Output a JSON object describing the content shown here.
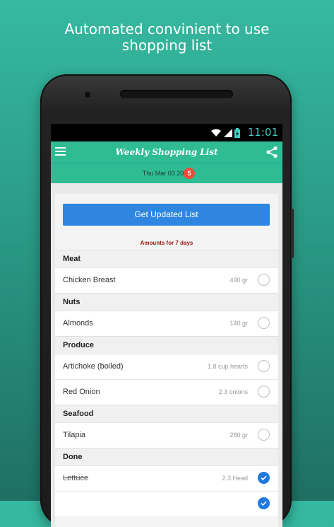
{
  "headline": {
    "line1": "Automated convinient to use",
    "line2": "shopping list"
  },
  "statusbar": {
    "time": "11:01",
    "icons": [
      "wifi-icon",
      "signal-icon",
      "battery-icon"
    ]
  },
  "appbar": {
    "title": "Weekly Shopping List",
    "menu_icon": "menu-icon",
    "share_icon": "share-icon"
  },
  "datebar": {
    "date": "Thu Mar 03 2016",
    "badge": "5"
  },
  "main": {
    "button_label": "Get Updated List",
    "amounts_label": "Amounts for 7 days"
  },
  "sections": [
    {
      "category": "Meat",
      "items": [
        {
          "name": "Chicken Breast",
          "amount": "490 gr",
          "checked": false
        }
      ]
    },
    {
      "category": "Nuts",
      "items": [
        {
          "name": "Almonds",
          "amount": "140 gr",
          "checked": false
        }
      ]
    },
    {
      "category": "Produce",
      "items": [
        {
          "name": "Artichoke (boiled)",
          "amount": "1.8 cup hearts",
          "checked": false
        },
        {
          "name": "Red Onion",
          "amount": "2.3 onions",
          "checked": false
        }
      ]
    },
    {
      "category": "Seafood",
      "items": [
        {
          "name": "Tilapia",
          "amount": "280 gr",
          "checked": false
        }
      ]
    },
    {
      "category": "Done",
      "items": [
        {
          "name": "Lettuce",
          "amount": "2.3 Head",
          "checked": true
        },
        {
          "name": "",
          "amount": "",
          "checked": true
        }
      ]
    }
  ],
  "colors": {
    "accent": "#2fbc95",
    "button": "#2e86e0",
    "badge": "#f04b3a",
    "amounts_text": "#9c1414",
    "checked": "#1f79e0"
  }
}
